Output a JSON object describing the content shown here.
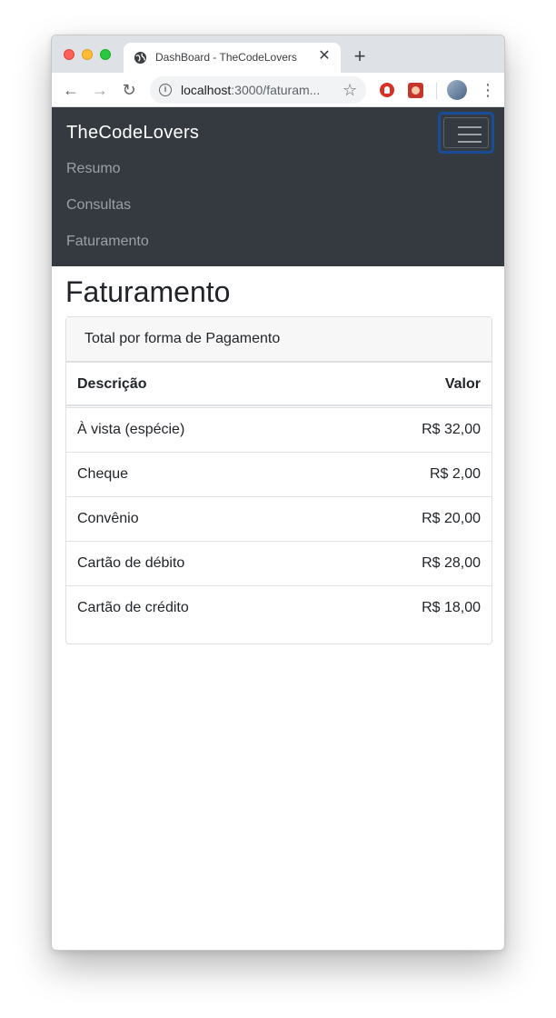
{
  "browser": {
    "tab_title": "DashBoard - TheCodeLovers",
    "tab_close": "✕",
    "new_tab": "+",
    "url_host": "localhost",
    "url_rest": ":3000/faturam...",
    "back": "←",
    "forward": "→",
    "reload": "↻",
    "info": "i",
    "star": "☆",
    "menu": "⋮"
  },
  "navbar": {
    "brand": "TheCodeLovers",
    "items": [
      {
        "label": "Resumo"
      },
      {
        "label": "Consultas"
      },
      {
        "label": "Faturamento"
      }
    ]
  },
  "main": {
    "title": "Faturamento",
    "card_header": "Total por forma de Pagamento",
    "table": {
      "headers": [
        "Descrição",
        "Valor"
      ],
      "rows": [
        [
          "À vista (espécie)",
          "R$ 32,00"
        ],
        [
          "Cheque",
          "R$ 2,00"
        ],
        [
          "Convênio",
          "R$ 20,00"
        ],
        [
          "Cartão de débito",
          "R$ 28,00"
        ],
        [
          "Cartão de crédito",
          "R$ 18,00"
        ]
      ]
    }
  },
  "colors": {
    "navbar_bg": "#343a40",
    "toggler_focus": "#1a4d99",
    "text": "#212529"
  }
}
